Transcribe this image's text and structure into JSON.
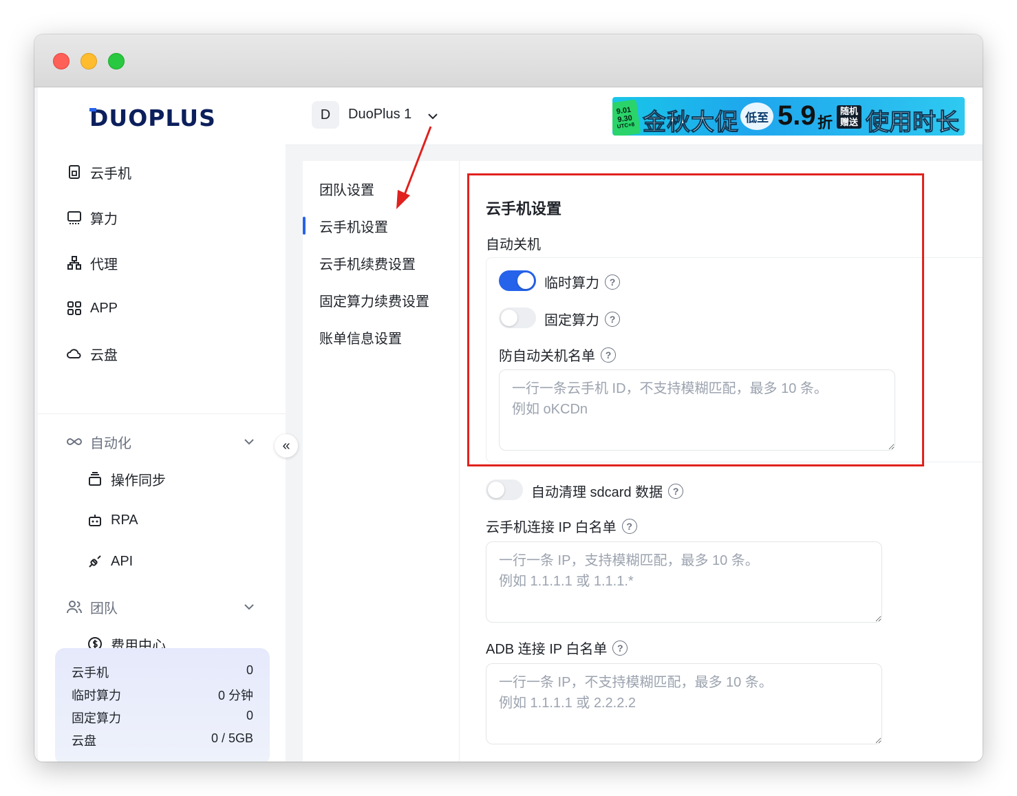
{
  "brand": {
    "logo_text": "DUOPLUS"
  },
  "sidebar": {
    "items": [
      {
        "label": "云手机",
        "icon": "phone-icon"
      },
      {
        "label": "算力",
        "icon": "monitor-icon"
      },
      {
        "label": "代理",
        "icon": "network-icon"
      },
      {
        "label": "APP",
        "icon": "apps-grid-icon"
      },
      {
        "label": "云盘",
        "icon": "cloud-icon"
      }
    ],
    "groups": [
      {
        "label": "自动化",
        "icon": "infinity-icon",
        "children": [
          {
            "label": "操作同步",
            "icon": "sync-stack-icon"
          },
          {
            "label": "RPA",
            "icon": "robot-icon"
          },
          {
            "label": "API",
            "icon": "plug-icon"
          }
        ]
      },
      {
        "label": "团队",
        "icon": "users-icon",
        "children": [
          {
            "label": "费用中心",
            "icon": "dollar-icon"
          }
        ]
      }
    ],
    "stats": [
      {
        "label": "云手机",
        "value": "0"
      },
      {
        "label": "临时算力",
        "value": "0 分钟"
      },
      {
        "label": "固定算力",
        "value": "0"
      },
      {
        "label": "云盘",
        "value": "0 / 5GB"
      }
    ],
    "collapse_glyph": "«"
  },
  "topbar": {
    "team_initial": "D",
    "team_name": "DuoPlus 1",
    "banner": {
      "date_top": "9.01",
      "date_bottom": "9.30",
      "tz": "UTC+8",
      "headline": "金秋大促",
      "badge": "低至",
      "price": "5.9",
      "discount_unit": "折",
      "gift": "随机赠送",
      "tail": "使用时长"
    }
  },
  "subnav": {
    "items": [
      "团队设置",
      "云手机设置",
      "云手机续费设置",
      "固定算力续费设置",
      "账单信息设置"
    ],
    "active_index": 1
  },
  "settings": {
    "title": "云手机设置",
    "auto_shutdown": {
      "label": "自动关机",
      "temp_compute": {
        "label": "临时算力",
        "enabled": true
      },
      "fixed_compute": {
        "label": "固定算力",
        "enabled": false
      },
      "whitelist_label": "防自动关机名单",
      "whitelist_placeholder": "一行一条云手机 ID，不支持模糊匹配，最多 10 条。\n例如 oKCDn"
    },
    "auto_clean": {
      "label": "自动清理 sdcard 数据",
      "enabled": false
    },
    "phone_ip_whitelist": {
      "label": "云手机连接 IP 白名单",
      "placeholder": "一行一条 IP，支持模糊匹配，最多 10 条。\n例如 1.1.1.1 或 1.1.1.*"
    },
    "adb_ip_whitelist": {
      "label": "ADB 连接 IP 白名单",
      "placeholder": "一行一条 IP，不支持模糊匹配，最多 10 条。\n例如 1.1.1.1 或 2.2.2.2"
    }
  },
  "colors": {
    "accent": "#2563eb",
    "annotation_red": "#e0211d",
    "stats_bg": "#e6e9fb"
  }
}
